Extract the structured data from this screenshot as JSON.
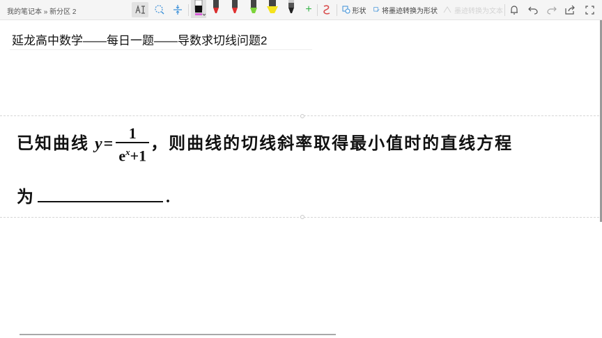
{
  "breadcrumb": {
    "notebook": "我的笔记本",
    "sep": "»",
    "section": "新分区 2"
  },
  "toolbar": {
    "shape_label": "形状",
    "ink_to_shape_label": "将墨迹转换为形状",
    "ink_to_text_label": "墨迹转换为文本",
    "pens": [
      {
        "name": "black-pen",
        "color": "#111111"
      },
      {
        "name": "red-pen",
        "color": "#d92c2c"
      },
      {
        "name": "red-pen-2",
        "color": "#e03030"
      },
      {
        "name": "green-highlighter",
        "color": "#7cd43a"
      },
      {
        "name": "yellow-highlighter",
        "color": "#f5e31d"
      },
      {
        "name": "dark-pen",
        "color": "#222222"
      }
    ]
  },
  "page": {
    "title": "延龙高中数学——每日一题——导数求切线问题2"
  },
  "problem": {
    "line1_prefix": "已知曲线",
    "var": "y",
    "eq": "=",
    "numerator": "1",
    "den_base": "e",
    "den_exp": "x",
    "den_rest": "+1",
    "line1_suffix": "，则曲线的切线斜率取得最小值时的直线方程",
    "line2_prefix": "为",
    "line2_suffix": "."
  }
}
